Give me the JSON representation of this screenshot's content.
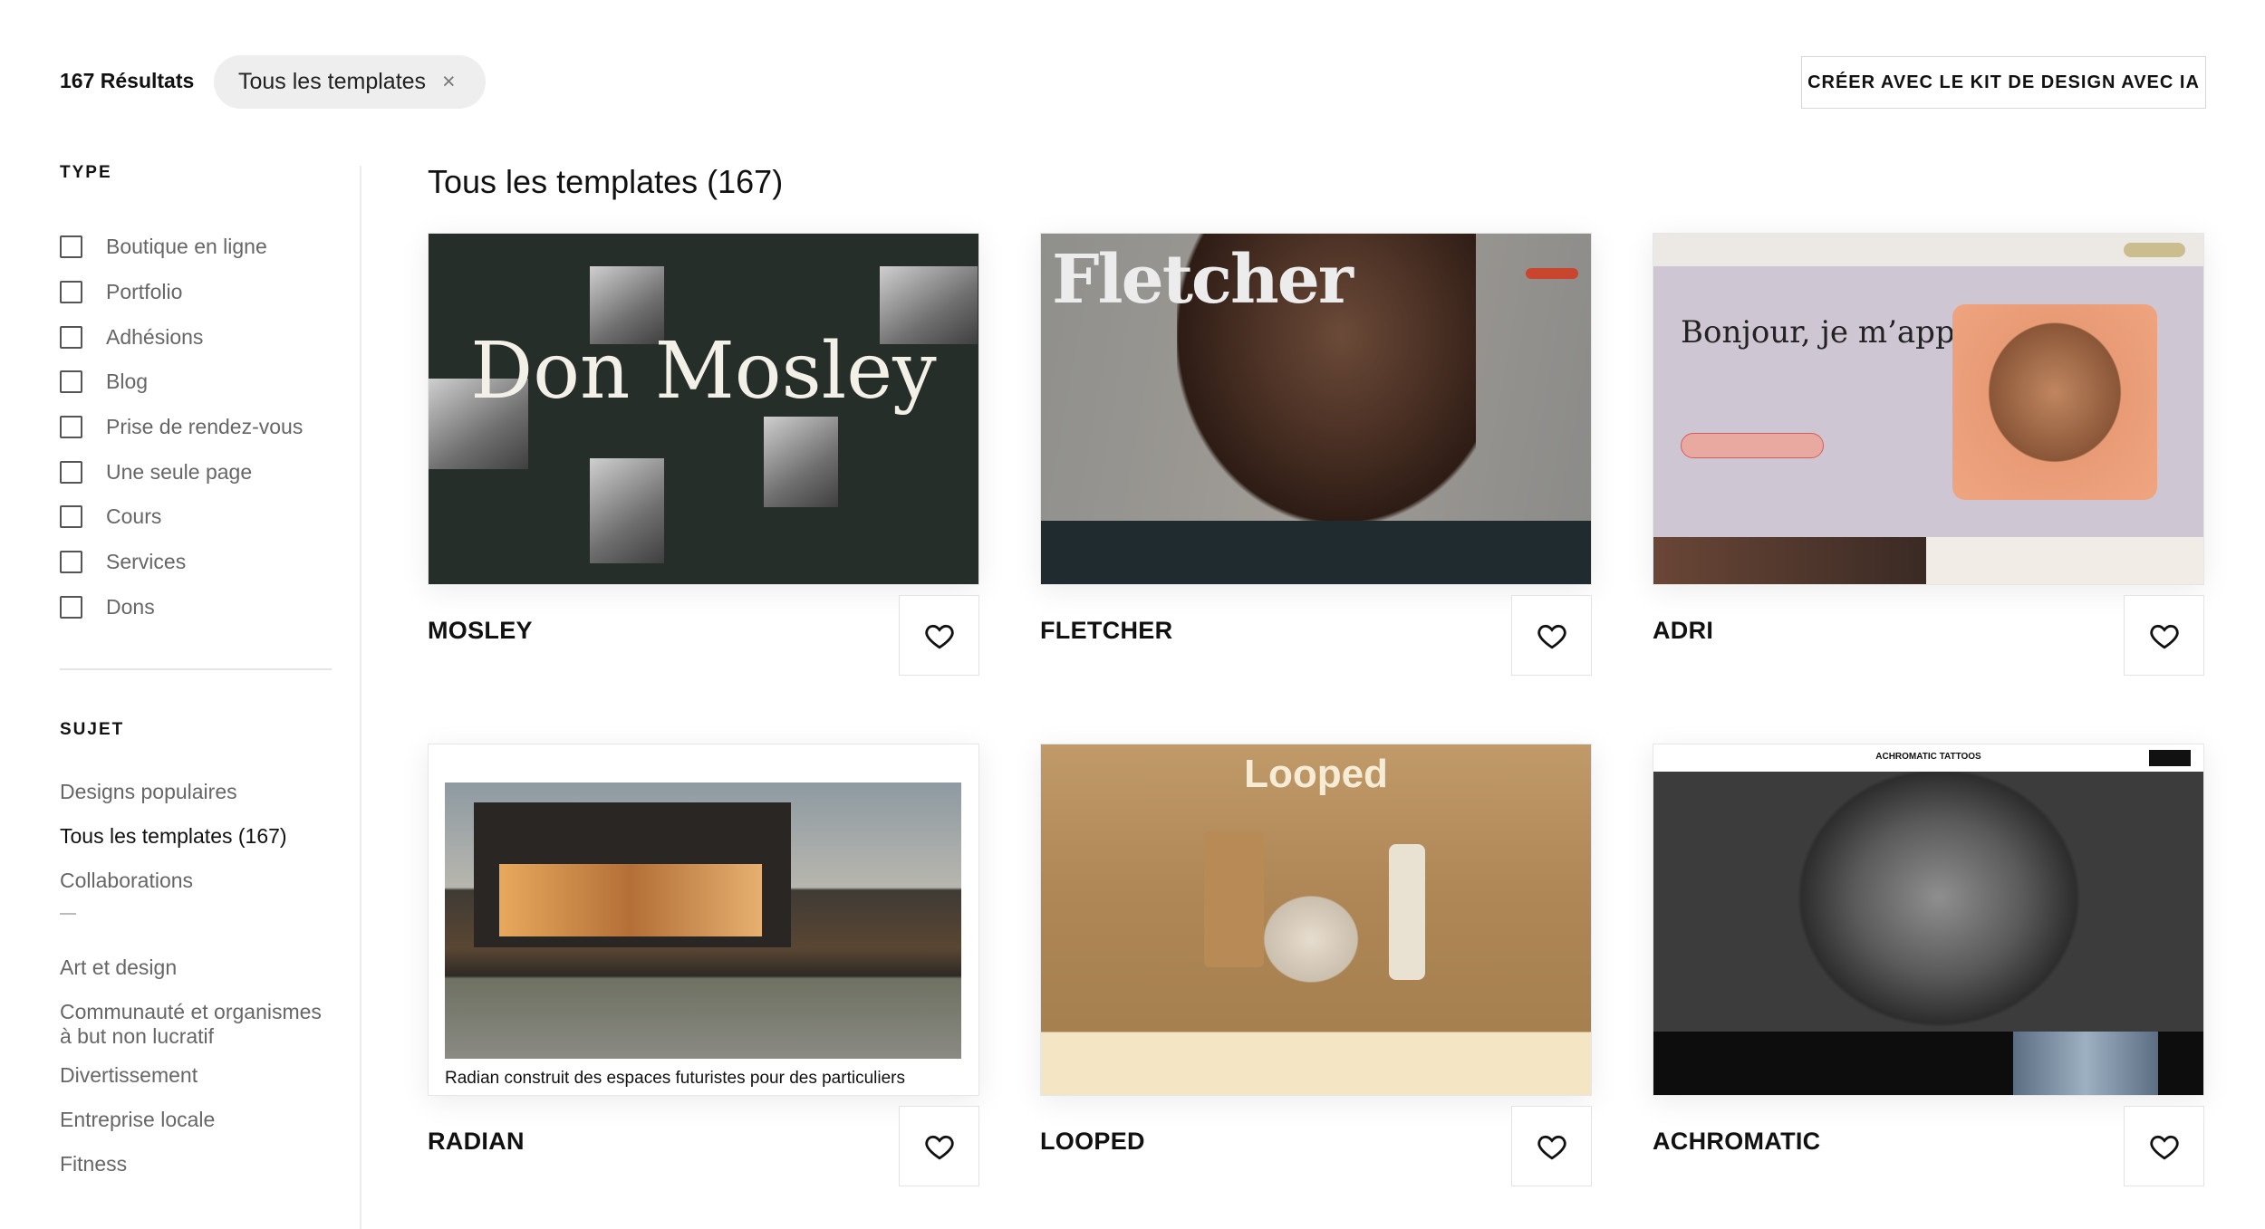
{
  "header": {
    "results_count": "167 Résultats",
    "filter_chip": {
      "label": "Tous les templates",
      "close_icon": "×"
    },
    "ai_kit_button": "CRÉER AVEC LE KIT DE DESIGN AVEC IA"
  },
  "sidebar": {
    "type_title": "TYPE",
    "type_items": [
      {
        "label": "Boutique en ligne",
        "checked": false
      },
      {
        "label": "Portfolio",
        "checked": false
      },
      {
        "label": "Adhésions",
        "checked": false
      },
      {
        "label": "Blog",
        "checked": false
      },
      {
        "label": "Prise de rendez-vous",
        "checked": false
      },
      {
        "label": "Une seule page",
        "checked": false
      },
      {
        "label": "Cours",
        "checked": false
      },
      {
        "label": "Services",
        "checked": false
      },
      {
        "label": "Dons",
        "checked": false
      }
    ],
    "subject_title": "SUJET",
    "subject_items": [
      {
        "label": "Designs populaires",
        "active": false
      },
      {
        "label": "Tous les templates (167)",
        "active": true
      },
      {
        "label": "Collaborations",
        "active": false
      },
      {
        "label": "Art et design",
        "active": false
      },
      {
        "label": "Communauté et organismes à but non lucratif",
        "active": false
      },
      {
        "label": "Divertissement",
        "active": false
      },
      {
        "label": "Entreprise locale",
        "active": false
      },
      {
        "label": "Fitness",
        "active": false
      }
    ]
  },
  "main": {
    "title": "Tous les templates (167)",
    "templates": [
      {
        "name": "MOSLEY",
        "preview_text": "Don Mosley",
        "favorite_icon": "heart-icon"
      },
      {
        "name": "FLETCHER",
        "preview_text": "Fletcher",
        "favorite_icon": "heart-icon"
      },
      {
        "name": "ADRI",
        "preview_text": "Bonjour, je m’appelle Adri.",
        "favorite_icon": "heart-icon"
      },
      {
        "name": "RADIAN",
        "preview_text": "Radian construit des espaces futuristes pour des particuliers",
        "favorite_icon": "heart-icon"
      },
      {
        "name": "LOOPED",
        "preview_text": "Looped",
        "favorite_icon": "heart-icon"
      },
      {
        "name": "ACHROMATIC",
        "preview_text": "ACHROMATIC TATTOOS",
        "favorite_icon": "heart-icon"
      }
    ]
  },
  "colors": {
    "text_primary": "#111111",
    "text_muted": "#666666",
    "chip_bg": "#eeeeee",
    "border": "#e3e3e3"
  }
}
